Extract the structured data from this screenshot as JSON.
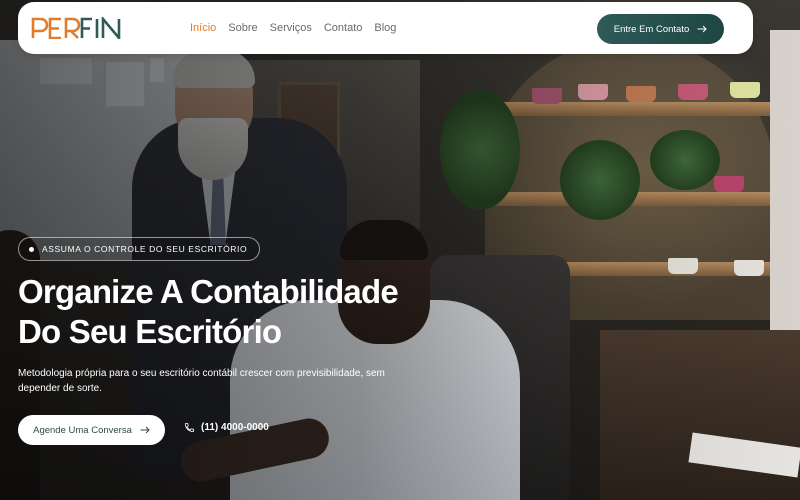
{
  "brand": {
    "logo_text": "PERFIN",
    "colors": {
      "orange": "#e07b2f",
      "teal": "#2e5a58",
      "nav_active": "#e07b2f"
    }
  },
  "nav": {
    "links": [
      {
        "label": "Início",
        "active": true
      },
      {
        "label": "Sobre",
        "active": false
      },
      {
        "label": "Serviços",
        "active": false
      },
      {
        "label": "Contato",
        "active": false
      },
      {
        "label": "Blog",
        "active": false
      }
    ],
    "cta_label": "Entre Em Contato",
    "cta_icon": "arrow-right-icon"
  },
  "hero": {
    "badge": "Assuma o controle do seu escritório",
    "title_line1": "Organize A Contabilidade",
    "title_line2": "Do Seu Escritório",
    "subtitle": "Metodologia própria para o seu escritório contábil crescer com previsibilidade, sem depender de sorte.",
    "primary_cta": "Agende Uma Conversa",
    "primary_cta_icon": "arrow-right-icon",
    "phone_icon": "phone-icon",
    "phone": "(11) 4000-0000"
  }
}
